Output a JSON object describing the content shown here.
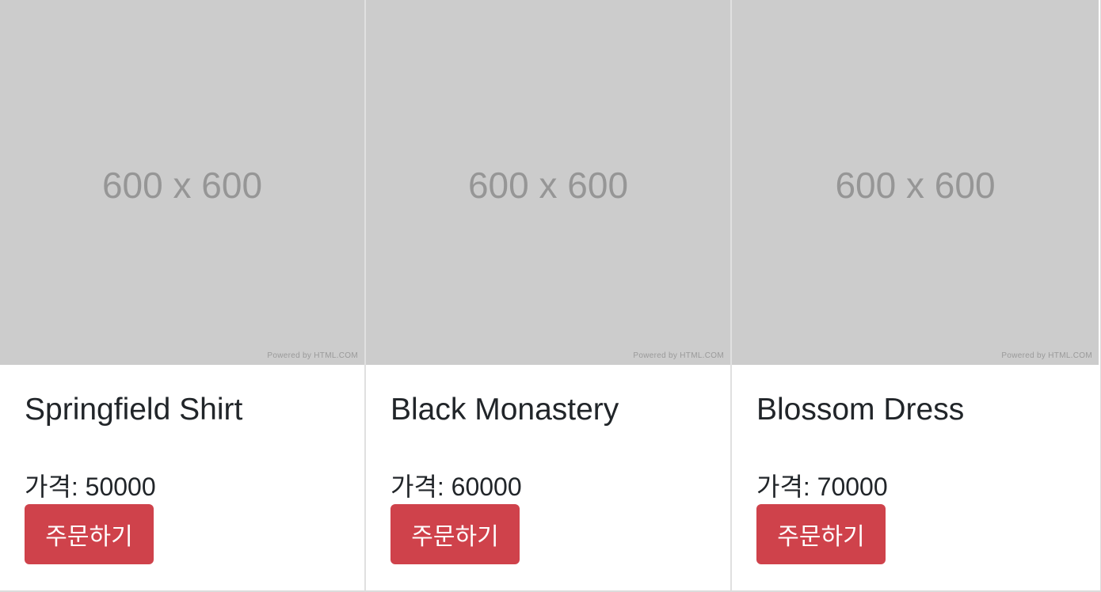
{
  "products": [
    {
      "image_text": "600 x 600",
      "image_credit": "Powered by HTML.COM",
      "title": "Springfield Shirt",
      "price_text": "가격: 50000",
      "button_label": "주문하기"
    },
    {
      "image_text": "600 x 600",
      "image_credit": "Powered by HTML.COM",
      "title": "Black Monastery",
      "price_text": "가격: 60000",
      "button_label": "주문하기"
    },
    {
      "image_text": "600 x 600",
      "image_credit": "Powered by HTML.COM",
      "title": "Blossom Dress",
      "price_text": "가격: 70000",
      "button_label": "주문하기"
    }
  ],
  "colors": {
    "placeholder_bg": "#cccccc",
    "placeholder_text": "#969696",
    "button_bg": "#cf424b",
    "button_text": "#ffffff",
    "text": "#212529"
  }
}
